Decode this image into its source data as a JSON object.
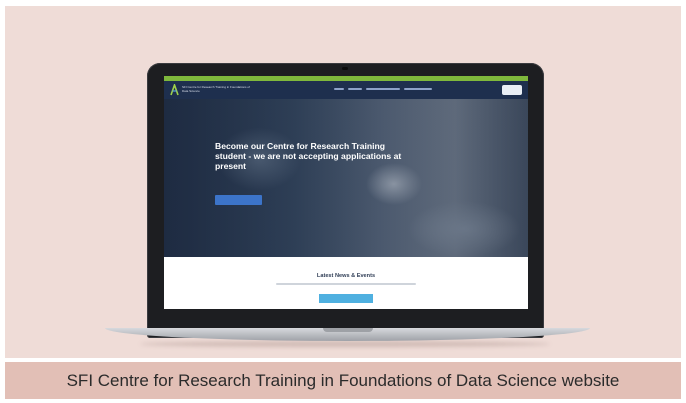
{
  "caption": "SFI Centre for Research Training in Foundations of Data Science website",
  "site": {
    "logo_text": "SFI Centre for Research Training in Foundations of Data Science",
    "hero_title": "Become our Centre for Research Training student - we are not accepting applications at present",
    "news_title": "Latest News & Events",
    "colors": {
      "topbar": "#7fb83c",
      "header": "#1e2f4e",
      "hero_button": "#3c74c9",
      "news_button": "#4fb0e0"
    }
  }
}
